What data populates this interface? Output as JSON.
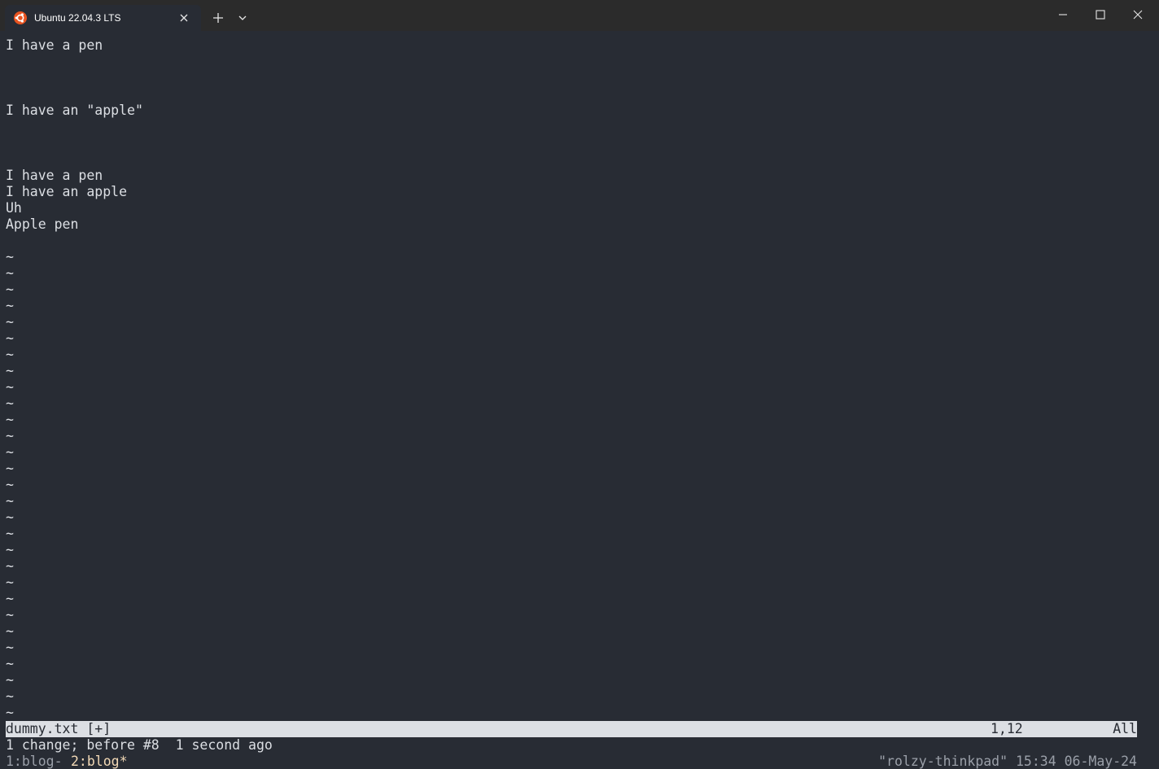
{
  "window": {
    "tab_title": "Ubuntu 22.04.3 LTS"
  },
  "icons": {
    "tab": "ubuntu-logo-icon",
    "tab_close": "close-icon",
    "new_tab": "plus-icon",
    "dropdown": "chevron-down-icon",
    "minimize": "minimize-icon",
    "maximize": "maximize-icon",
    "close": "close-icon"
  },
  "colors": {
    "terminal_bg": "#282c34",
    "terminal_fg": "#dcdfe4",
    "ubuntu_orange": "#e95420",
    "titlebar_bg": "#2b2b2b"
  },
  "buffer": {
    "lines": [
      "I have a pen",
      "",
      "",
      "",
      "I have an \"apple\"",
      "",
      "",
      "",
      "I have a pen",
      "I have an apple",
      "Uh",
      "Apple pen",
      ""
    ],
    "empty_line_marker": "~",
    "empty_line_count": 29
  },
  "statusline": {
    "filename": "dummy.txt [+]",
    "position": "1,12",
    "scroll": "All"
  },
  "message": "1 change; before #8  1 second ago",
  "tmux": {
    "window1": "1:blog-",
    "window2": "2:blog*",
    "status_right": "\"rolzy-thinkpad\" 15:34 06-May-24"
  }
}
